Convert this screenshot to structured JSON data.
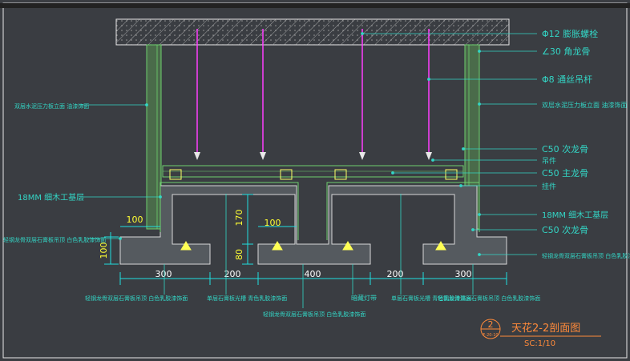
{
  "colors": {
    "background": "#3a3d42",
    "frame": "#e8e8e8",
    "board": "#6fd06f",
    "board_fill": "#4a6b4a",
    "stone": "#c8c8c8",
    "annotation": "#33d6c6",
    "dimension": "#20e0e0",
    "dim_text": "#ffffff",
    "level": "#ffff33",
    "title": "#ff8a3a",
    "rod": "#ff3fff",
    "clip": "#ffff66"
  },
  "labels": {
    "right_phi12": "Φ12 膨胀螺栓",
    "right_l30": "∠30 角龙骨",
    "right_phi8": "Φ8 通丝吊杆",
    "right_side_wall": "双层水泥压力板立面 油漆饰面",
    "right_c50_sub": "C50 次龙骨",
    "right_hanger": "吊件",
    "right_c50_main": "C50 主龙骨",
    "right_hanger2": "挂件",
    "right_18mm": "18MM 细木工基层",
    "right_c50_sub2": "C50 次龙骨",
    "right_gypsum": "轻钢龙骨双层石膏板吊顶 白色乳胶漆饰面",
    "left_side_wall": "双层水泥压力板立面 油漆饰面",
    "left_18mm": "18MM 细木工基层",
    "left_gypsum": "轻钢龙骨双层石膏板吊顶 白色乳胶漆饰面",
    "bottom_1": "轻钢龙骨双层石膏板吊顶 白色乳胶漆饰面",
    "bottom_2": "单层石膏板光槽 青色乳胶漆饰面",
    "bottom_3": "轻钢龙骨双层石膏板吊顶 白色乳胶漆饰面",
    "bottom_4": "暗藏灯带",
    "bottom_5": "单层石膏板光槽 青色乳胶漆饰面",
    "bottom_6": "轻钢龙骨双层石膏板吊顶 白色乳胶漆饰面"
  },
  "dimensions": {
    "d300a": "300",
    "d200a": "200",
    "d400": "400",
    "d200b": "200",
    "d300b": "300",
    "d100h": "100",
    "d100v": "100",
    "d170": "170",
    "d100c": "100",
    "d80": "80"
  },
  "title_block": {
    "number": "2",
    "sheet": "F-20-10",
    "title": "天花2-2剖面图",
    "scale": "SC:1/10"
  }
}
